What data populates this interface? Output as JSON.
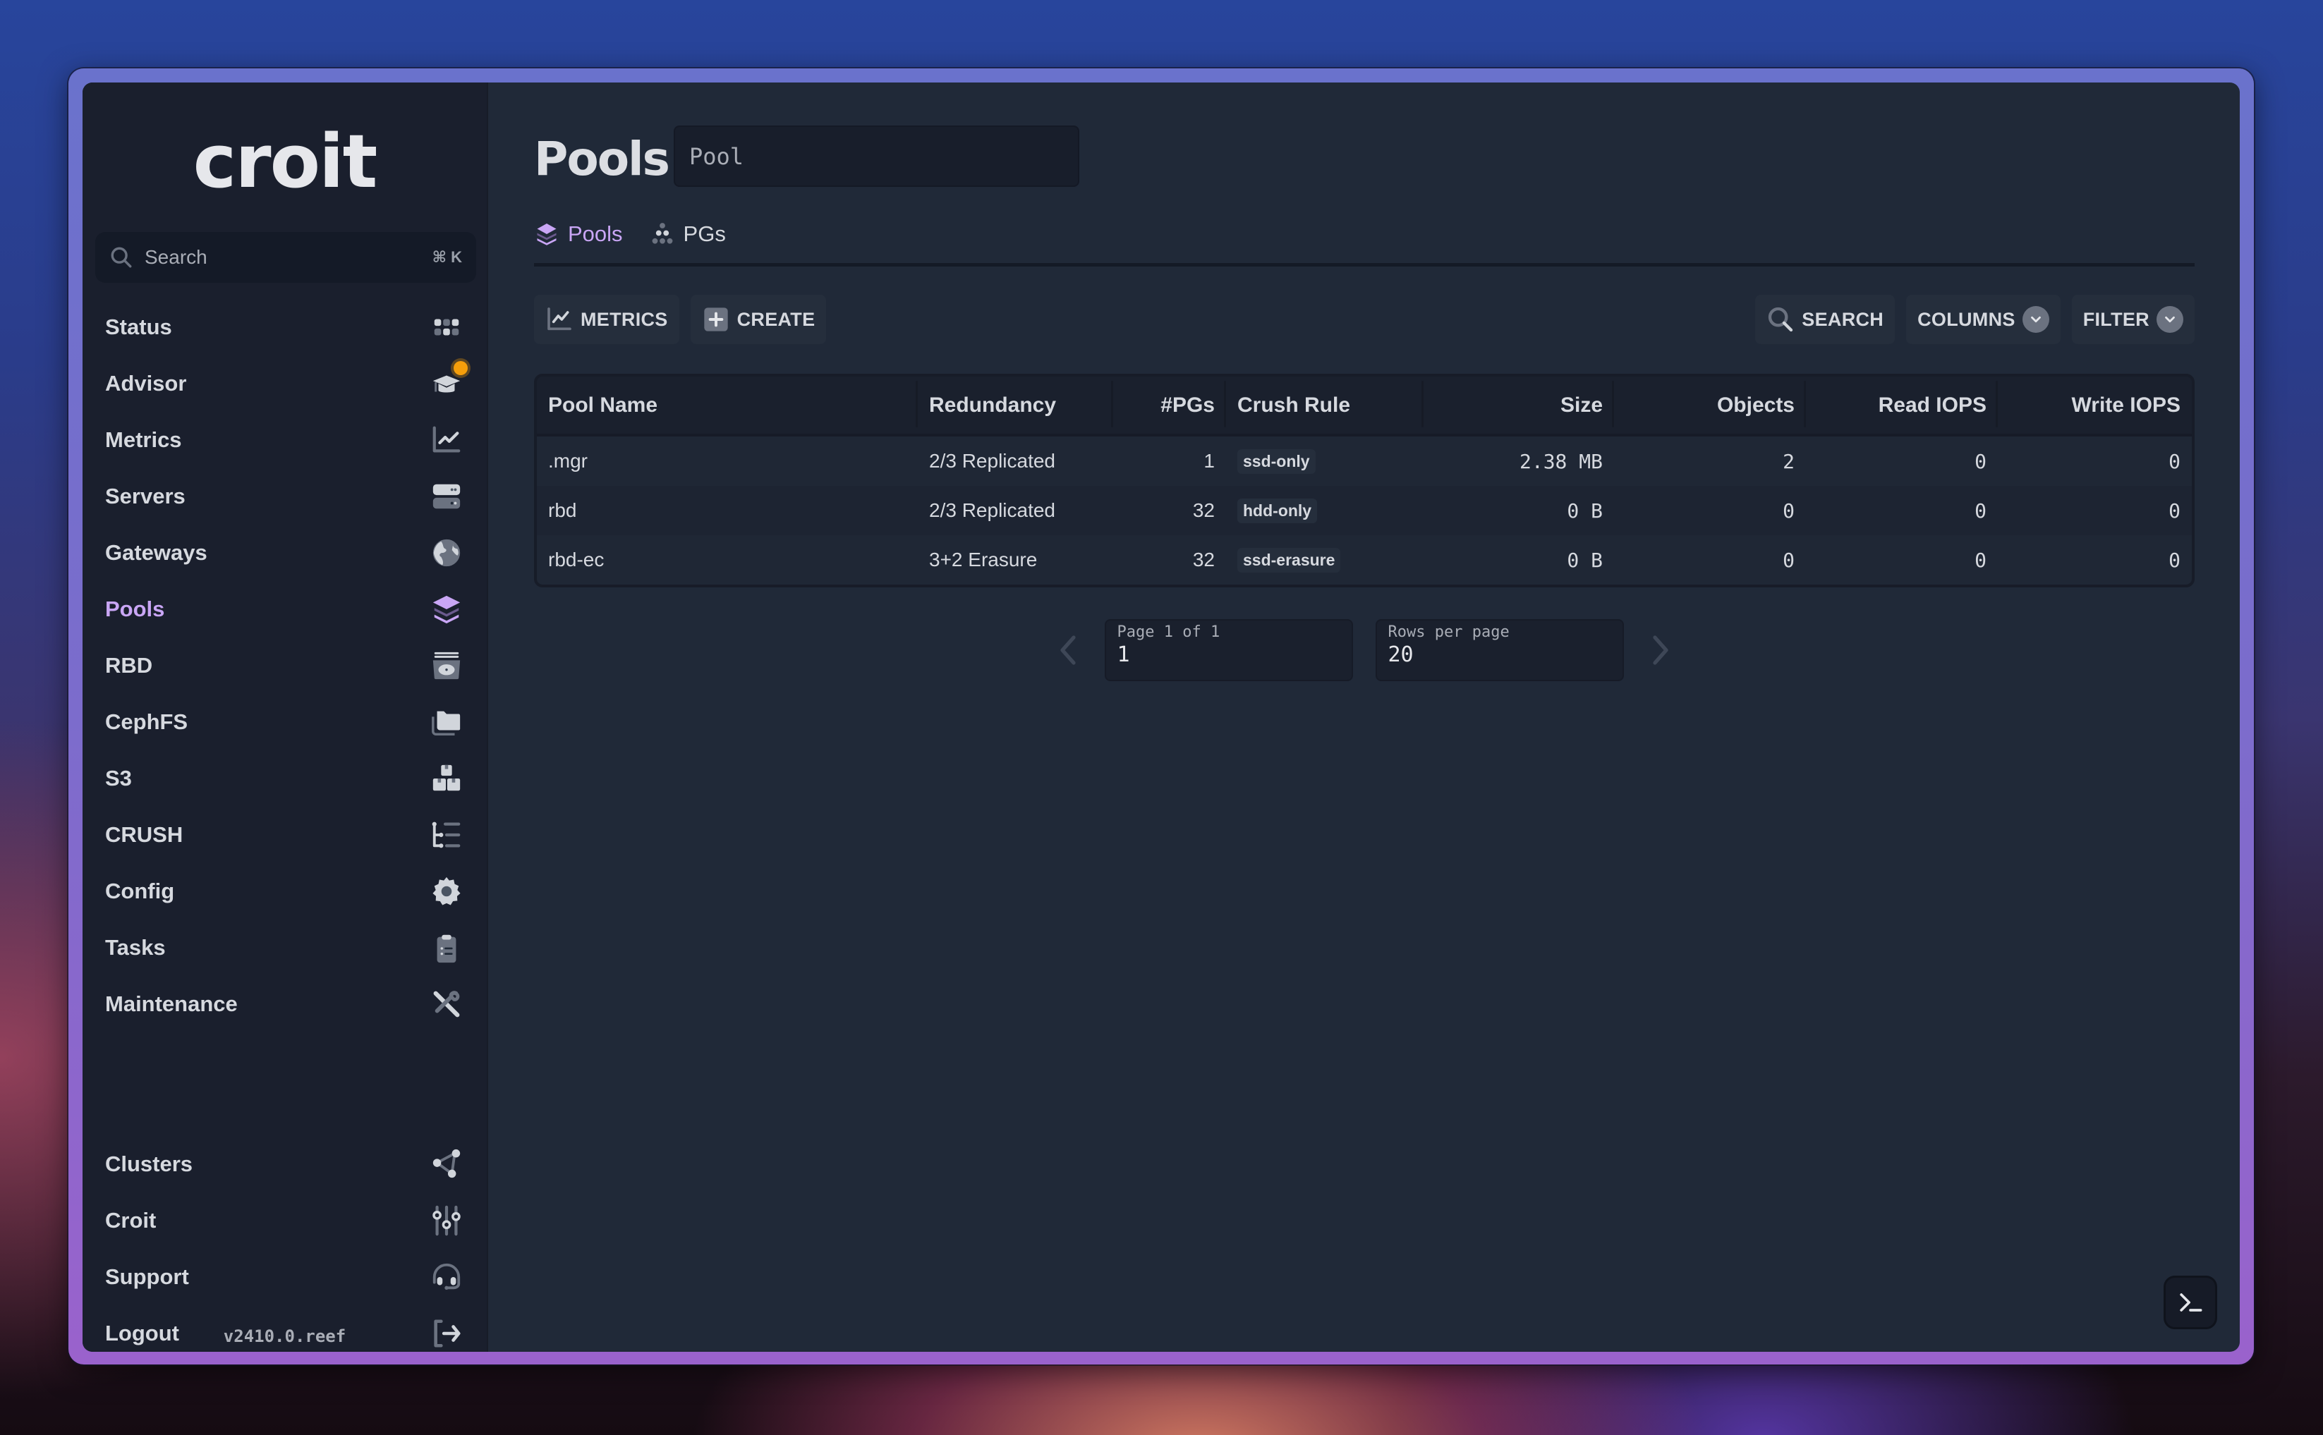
{
  "brand": {
    "logo_text": "croit",
    "version": "v2410.0.reef"
  },
  "sidebar": {
    "search": {
      "placeholder": "Search",
      "shortcut": "⌘ K"
    },
    "items": [
      {
        "label": "Status",
        "icon": "grid-icon"
      },
      {
        "label": "Advisor",
        "icon": "graduation-cap-icon",
        "notification": true
      },
      {
        "label": "Metrics",
        "icon": "line-chart-icon"
      },
      {
        "label": "Servers",
        "icon": "server-icon"
      },
      {
        "label": "Gateways",
        "icon": "globe-icon"
      },
      {
        "label": "Pools",
        "icon": "layers-icon",
        "active": true
      },
      {
        "label": "RBD",
        "icon": "disk-icon"
      },
      {
        "label": "CephFS",
        "icon": "folders-icon"
      },
      {
        "label": "S3",
        "icon": "boxes-icon"
      },
      {
        "label": "CRUSH",
        "icon": "tree-list-icon"
      },
      {
        "label": "Config",
        "icon": "gear-icon"
      },
      {
        "label": "Tasks",
        "icon": "clipboard-icon"
      },
      {
        "label": "Maintenance",
        "icon": "tools-icon"
      }
    ],
    "bottom_items": [
      {
        "label": "Clusters",
        "icon": "share-nodes-icon"
      },
      {
        "label": "Croit",
        "icon": "sliders-icon"
      },
      {
        "label": "Support",
        "icon": "headset-icon"
      },
      {
        "label": "Logout",
        "icon": "logout-icon"
      }
    ]
  },
  "header": {
    "title": "Pools",
    "input_value": "Pool"
  },
  "tabs": [
    {
      "label": "Pools",
      "icon": "layers-icon",
      "active": true
    },
    {
      "label": "PGs",
      "icon": "dots-cluster-icon",
      "active": false
    }
  ],
  "toolbar": {
    "metrics_label": "METRICS",
    "create_label": "CREATE",
    "search_label": "SEARCH",
    "columns_label": "COLUMNS",
    "filter_label": "FILTER"
  },
  "table": {
    "columns": [
      "Pool Name",
      "Redundancy",
      "#PGs",
      "Crush Rule",
      "Size",
      "Objects",
      "Read IOPS",
      "Write IOPS"
    ],
    "rows": [
      {
        "name": ".mgr",
        "redundancy": "2/3 Replicated",
        "pgs": "1",
        "rule": "ssd-only",
        "size": "2.38 MB",
        "objects": "2",
        "read_iops": "0",
        "write_iops": "0"
      },
      {
        "name": "rbd",
        "redundancy": "2/3 Replicated",
        "pgs": "32",
        "rule": "hdd-only",
        "size": "0 B",
        "objects": "0",
        "read_iops": "0",
        "write_iops": "0"
      },
      {
        "name": "rbd-ec",
        "redundancy": "3+2 Erasure",
        "pgs": "32",
        "rule": "ssd-erasure",
        "size": "0 B",
        "objects": "0",
        "read_iops": "0",
        "write_iops": "0"
      }
    ]
  },
  "pagination": {
    "page_label": "Page 1 of 1",
    "page_value": "1",
    "rows_label": "Rows per page",
    "rows_value": "20"
  },
  "colors": {
    "accent": "#c9a6f5",
    "badge": "#f59e0b",
    "sidebar_bg": "#1a1f2d",
    "main_bg": "#202938"
  }
}
